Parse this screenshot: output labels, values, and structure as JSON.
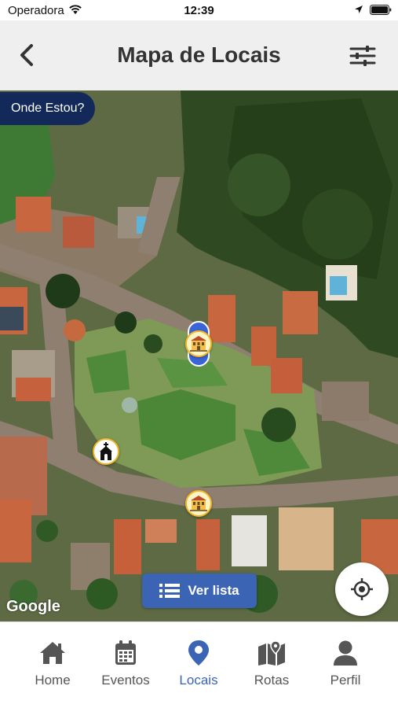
{
  "status_bar": {
    "carrier": "Operadora",
    "time": "12:39"
  },
  "header": {
    "title": "Mapa de Locais",
    "back_icon": "chevron-left-icon",
    "filter_icon": "sliders-icon"
  },
  "map": {
    "where_am_i_label": "Onde Estou?",
    "list_button_label": "Ver lista",
    "attribution": "Google",
    "markers": [
      {
        "type": "building",
        "icon": "town-hall-icon"
      },
      {
        "type": "church",
        "icon": "church-icon"
      },
      {
        "type": "building",
        "icon": "town-hall-icon"
      }
    ]
  },
  "tab_bar": {
    "items": [
      {
        "label": "Home",
        "icon": "home-icon"
      },
      {
        "label": "Eventos",
        "icon": "calendar-icon"
      },
      {
        "label": "Locais",
        "icon": "map-pin-icon"
      },
      {
        "label": "Rotas",
        "icon": "map-icon"
      },
      {
        "label": "Perfil",
        "icon": "user-icon"
      }
    ],
    "active": "Locais"
  },
  "colors": {
    "primary": "#3b64b4",
    "dark_navy": "#13295a",
    "header_bg": "#efefef",
    "icon_gray": "#555555"
  }
}
